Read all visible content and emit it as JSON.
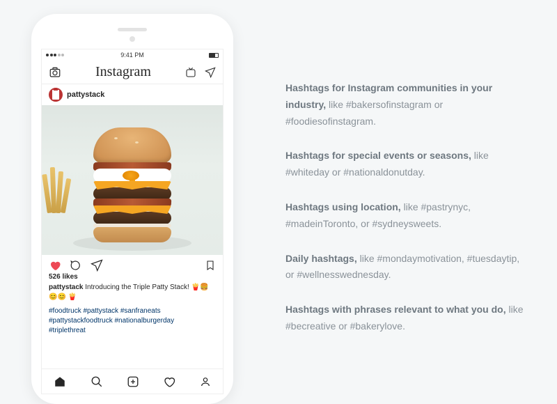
{
  "phone": {
    "time": "9:41 PM",
    "app_logo": "Instagram",
    "username": "pattystack",
    "likes_label": "526 likes",
    "caption_user": "pattystack",
    "caption_text": " Introducing the Triple Patty Stack! ",
    "caption_emoji": "🍟🍔😊😊 🍟",
    "hashtags_line1": "#foodtruck #pattystack #sanfraneats",
    "hashtags_line2": "#pattystackfoodtruck #nationalburgerday",
    "hashtags_line3": "#triplethreat"
  },
  "tips": [
    {
      "bold": "Hashtags for Instagram communities in your industry,",
      "rest": " like #bakersofinstagram or #foodiesofinstagram."
    },
    {
      "bold": "Hashtags for special events or seasons,",
      "rest": " like #whiteday or #nationaldonutday."
    },
    {
      "bold": "Hashtags using location,",
      "rest": " like #pastrynyc, #madeinToronto, or #sydneysweets."
    },
    {
      "bold": "Daily hashtags,",
      "rest": " like #mondaymotivation, #tuesdaytip, or #wellnesswednesday."
    },
    {
      "bold": "Hashtags with phrases relevant to what you do,",
      "rest": " like #becreative or #bakerylove."
    }
  ]
}
